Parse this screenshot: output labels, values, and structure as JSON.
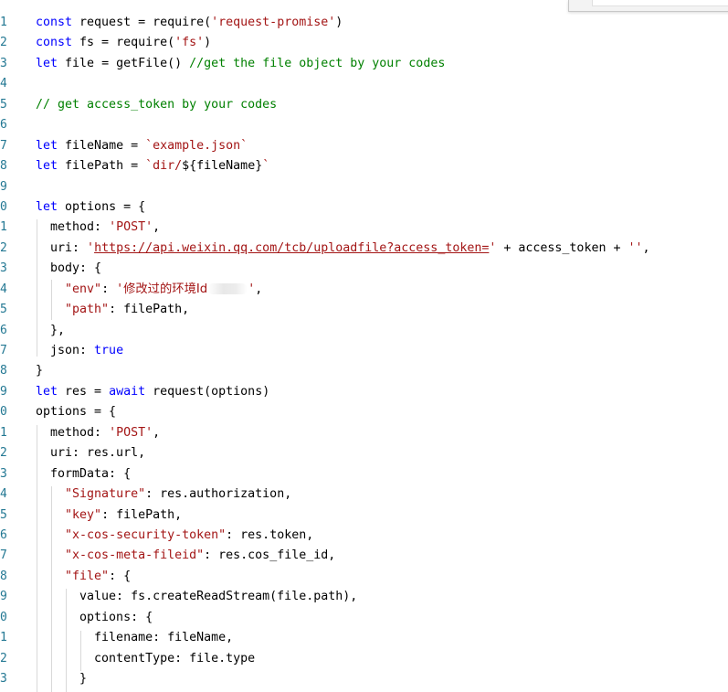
{
  "editor": {
    "line_numbers": [
      "1",
      "2",
      "3",
      "4",
      "5",
      "6",
      "7",
      "8",
      "9",
      "0",
      "1",
      "2",
      "3",
      "4",
      "5",
      "6",
      "7",
      "8",
      "9",
      "0",
      "1",
      "2",
      "3",
      "4",
      "5",
      "6",
      "7",
      "8",
      "9",
      "0",
      "1",
      "2",
      "3"
    ],
    "lines": [
      [
        {
          "t": "const",
          "c": "kw"
        },
        {
          "t": " request = require("
        },
        {
          "t": "'request-promise'",
          "c": "str"
        },
        {
          "t": ")"
        }
      ],
      [
        {
          "t": "const",
          "c": "kw"
        },
        {
          "t": " fs = require("
        },
        {
          "t": "'fs'",
          "c": "str"
        },
        {
          "t": ")"
        }
      ],
      [
        {
          "t": "let",
          "c": "kw"
        },
        {
          "t": " file = getFile() "
        },
        {
          "t": "//get the file object by your codes",
          "c": "cmt"
        }
      ],
      [],
      [
        {
          "t": "// get access_token by your codes",
          "c": "cmt"
        }
      ],
      [],
      [
        {
          "t": "let",
          "c": "kw"
        },
        {
          "t": " fileName = "
        },
        {
          "t": "`example.json`",
          "c": "str"
        }
      ],
      [
        {
          "t": "let",
          "c": "kw"
        },
        {
          "t": " filePath = "
        },
        {
          "t": "`dir/",
          "c": "str"
        },
        {
          "t": "${fileName}"
        },
        {
          "t": "`",
          "c": "str"
        }
      ],
      [],
      [
        {
          "t": "let",
          "c": "kw"
        },
        {
          "t": " options = {"
        }
      ],
      [
        {
          "t": "  method: "
        },
        {
          "t": "'POST'",
          "c": "str"
        },
        {
          "t": ","
        }
      ],
      [
        {
          "t": "  uri: "
        },
        {
          "t": "'",
          "c": "str"
        },
        {
          "t": "https://api.weixin.qq.com/tcb/uploadfile?access_token=",
          "c": "url"
        },
        {
          "t": "'",
          "c": "str"
        },
        {
          "t": " + access_token + "
        },
        {
          "t": "''",
          "c": "str"
        },
        {
          "t": ","
        }
      ],
      [
        {
          "t": "  body: {"
        }
      ],
      [
        {
          "t": "    "
        },
        {
          "t": "\"env\"",
          "c": "key"
        },
        {
          "t": ": "
        },
        {
          "t": "'",
          "c": "str"
        },
        {
          "t": "修改过的环境Id",
          "c": "str cjk"
        },
        {
          "t": "",
          "c": "blur"
        },
        {
          "t": "'",
          "c": "str"
        },
        {
          "t": ","
        }
      ],
      [
        {
          "t": "    "
        },
        {
          "t": "\"path\"",
          "c": "key"
        },
        {
          "t": ": filePath,"
        }
      ],
      [
        {
          "t": "  },"
        }
      ],
      [
        {
          "t": "  json: "
        },
        {
          "t": "true",
          "c": "kw"
        }
      ],
      [
        {
          "t": "}"
        }
      ],
      [
        {
          "t": "let",
          "c": "kw"
        },
        {
          "t": " res = "
        },
        {
          "t": "await",
          "c": "kw"
        },
        {
          "t": " request(options)"
        }
      ],
      [
        {
          "t": "options = {"
        }
      ],
      [
        {
          "t": "  method: "
        },
        {
          "t": "'POST'",
          "c": "str"
        },
        {
          "t": ","
        }
      ],
      [
        {
          "t": "  uri: res.url,"
        }
      ],
      [
        {
          "t": "  formData: {"
        }
      ],
      [
        {
          "t": "    "
        },
        {
          "t": "\"Signature\"",
          "c": "key"
        },
        {
          "t": ": res.authorization,"
        }
      ],
      [
        {
          "t": "    "
        },
        {
          "t": "\"key\"",
          "c": "key"
        },
        {
          "t": ": filePath,"
        }
      ],
      [
        {
          "t": "    "
        },
        {
          "t": "\"x-cos-security-token\"",
          "c": "key"
        },
        {
          "t": ": res.token,"
        }
      ],
      [
        {
          "t": "    "
        },
        {
          "t": "\"x-cos-meta-fileid\"",
          "c": "key"
        },
        {
          "t": ": res.cos_file_id,"
        }
      ],
      [
        {
          "t": "    "
        },
        {
          "t": "\"file\"",
          "c": "key"
        },
        {
          "t": ": {"
        }
      ],
      [
        {
          "t": "      value: fs.createReadStream(file.path),"
        }
      ],
      [
        {
          "t": "      options: {"
        }
      ],
      [
        {
          "t": "        filename: fileName,"
        }
      ],
      [
        {
          "t": "        contentType: file.type"
        }
      ],
      [
        {
          "t": "      }"
        }
      ]
    ]
  },
  "colors": {
    "keyword": "#0000ff",
    "string": "#a31515",
    "comment": "#008000",
    "line_number": "#237893",
    "indent_guide": "#d9d9d9"
  }
}
